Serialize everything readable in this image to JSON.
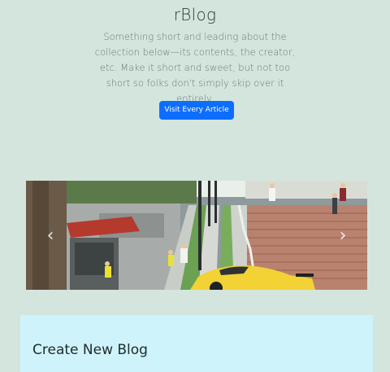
{
  "hero": {
    "title": "rBlog",
    "lead": "Something short and leading about the collection below—its contents, the creator, etc. Make it short and sweet, but not too short so folks don't simply skip over it entirely.",
    "cta_label": "Visit Every Article"
  },
  "carousel": {
    "prev_icon": "chevron-left-icon",
    "next_icon": "chevron-right-icon",
    "slide_alt": "City plaza with stairs, street lamps and a yellow sports car"
  },
  "create_panel": {
    "title": "Create New Blog"
  },
  "colors": {
    "background": "#d3e5dd",
    "button": "#0d6efd",
    "panel": "#cff3fb"
  }
}
